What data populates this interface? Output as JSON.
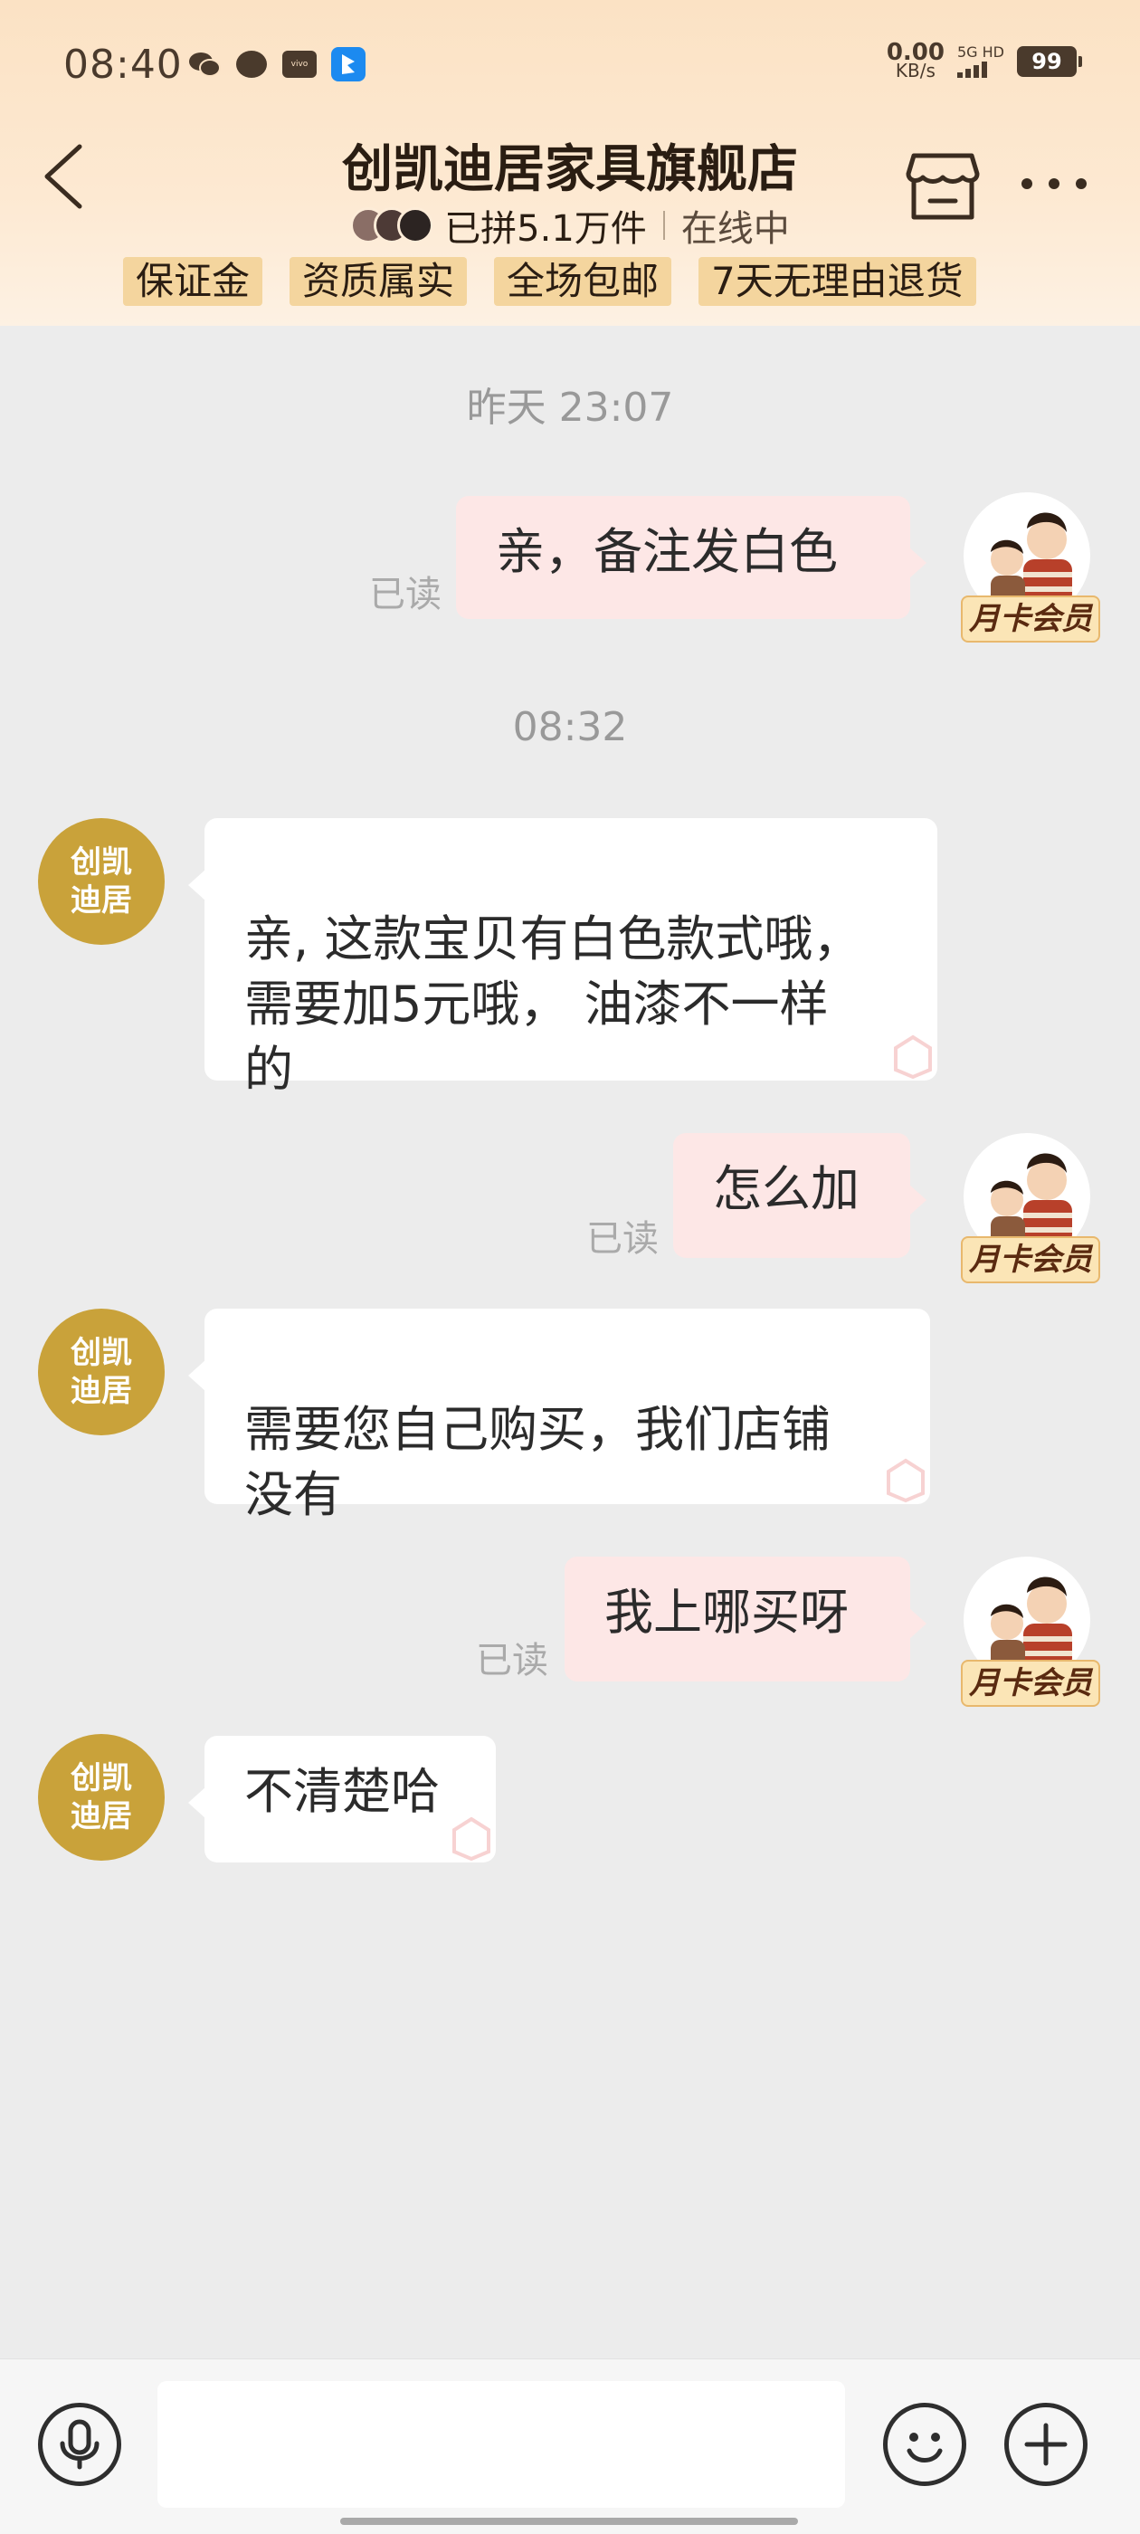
{
  "status_bar": {
    "time": "08:40",
    "net_speed_value": "0.00",
    "net_speed_unit": "KB/s",
    "network": "5G HD",
    "battery": "99",
    "app_icons": [
      "wechat-icon",
      "message-bubble-icon",
      "vivo-icon",
      "blue-app-icon"
    ]
  },
  "header": {
    "title": "创凯迪居家具旗舰店",
    "sales_text": "已拼5.1万件",
    "online_text": "在线中",
    "tags": [
      "保证金",
      "资质属实",
      "全场包邮",
      "7天无理由退货"
    ]
  },
  "chat": {
    "timestamps": [
      "昨天 23:07",
      "08:32"
    ],
    "read_label": "已读",
    "vip_label": "月卡会员",
    "shop_avatar_text": "创凯\n迪居",
    "messages": [
      {
        "from": "me",
        "text": "亲，备注发白色",
        "read": "已读"
      },
      {
        "from": "shop",
        "text": "亲, 这款宝贝有白色款式哦，\n需要加5元哦， 油漆不一样\n的"
      },
      {
        "from": "me",
        "text": "怎么加",
        "read": "已读"
      },
      {
        "from": "shop",
        "text": "需要您自己购买，我们店铺\n没有"
      },
      {
        "from": "me",
        "text": "我上哪买呀",
        "read": "已读"
      },
      {
        "from": "shop",
        "text": "不清楚哈"
      }
    ]
  },
  "input_bar": {
    "placeholder": "",
    "icons": [
      "microphone-icon",
      "emoji-icon",
      "plus-icon"
    ]
  },
  "colors": {
    "header_bg": "#fbe2c4",
    "tag_bg": "#f4d59e",
    "my_bubble": "#fde7e6",
    "shop_bubble": "#ffffff",
    "shop_avatar": "#c9a23a",
    "chat_bg": "#ececec"
  }
}
